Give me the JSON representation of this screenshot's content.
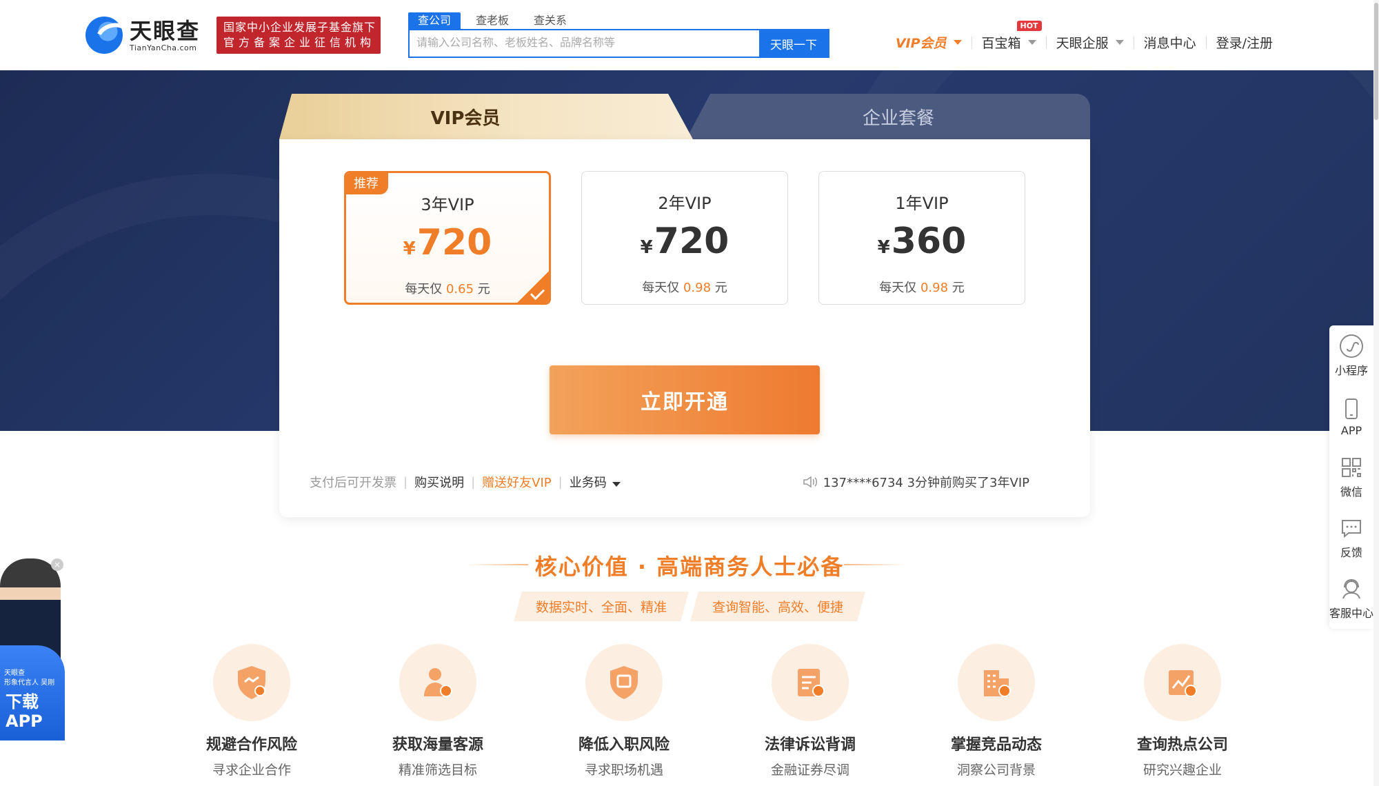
{
  "header": {
    "logo_cn": "天眼查",
    "logo_en": "TianYanCha.com",
    "badge_line1": "国家中小企业发展子基金旗下",
    "badge_line2": "官方备案企业征信机构",
    "search_tabs": [
      "查公司",
      "查老板",
      "查关系"
    ],
    "search_placeholder": "请输入公司名称、老板姓名、品牌名称等",
    "search_button": "天眼一下",
    "nav": {
      "vip": "VIP会员",
      "baibaoxiang": "百宝箱",
      "hot": "HOT",
      "qifu": "天眼企服",
      "messages": "消息中心",
      "login": "登录/注册"
    }
  },
  "tabs": {
    "vip": "VIP会员",
    "enterprise": "企业套餐"
  },
  "plans": [
    {
      "name": "3年VIP",
      "currency": "¥",
      "price": "720",
      "daily_prefix": "每天仅",
      "daily": "0.65",
      "daily_suffix": "元",
      "badge": "推荐",
      "selected": true
    },
    {
      "name": "2年VIP",
      "currency": "¥",
      "price": "720",
      "daily_prefix": "每天仅",
      "daily": "0.98",
      "daily_suffix": "元",
      "selected": false
    },
    {
      "name": "1年VIP",
      "currency": "¥",
      "price": "360",
      "daily_prefix": "每天仅",
      "daily": "0.98",
      "daily_suffix": "元",
      "selected": false
    }
  ],
  "cta": "立即开通",
  "footer_links": {
    "invoice": "支付后可开发票",
    "instructions": "购买说明",
    "gift": "赠送好友VIP",
    "business_code": "业务码"
  },
  "purchase_note": "137****6734 3分钟前购买了3年VIP",
  "core": {
    "title": "核心价值 · 高端商务人士必备",
    "tags": [
      "数据实时、全面、精准",
      "查询智能、高效、便捷"
    ],
    "features": [
      {
        "title": "规避合作风险",
        "sub": "寻求企业合作",
        "icon": "shield-handshake-icon"
      },
      {
        "title": "获取海量客源",
        "sub": "精准筛选目标",
        "icon": "user-search-icon"
      },
      {
        "title": "降低入职风险",
        "sub": "寻求职场机遇",
        "icon": "job-shield-icon"
      },
      {
        "title": "法律诉讼背调",
        "sub": "金融证券尽调",
        "icon": "clipboard-search-icon"
      },
      {
        "title": "掌握竞品动态",
        "sub": "洞察公司背景",
        "icon": "building-icon"
      },
      {
        "title": "查询热点公司",
        "sub": "研究兴趣企业",
        "icon": "trend-search-icon"
      }
    ]
  },
  "sidebar": [
    {
      "label": "小程序",
      "icon": "mini-program-icon"
    },
    {
      "label": "APP",
      "icon": "phone-icon"
    },
    {
      "label": "微信",
      "icon": "qr-code-icon"
    },
    {
      "label": "反馈",
      "icon": "feedback-icon"
    },
    {
      "label": "客服中心",
      "icon": "support-agent-icon"
    }
  ],
  "app_ad": {
    "close": "×",
    "brand_line1": "天眼查",
    "brand_line2": "形象代言人 吴刚",
    "download": "下载",
    "app": "APP"
  },
  "colors": {
    "brand_blue": "#1a73e8",
    "accent_orange": "#f07d28",
    "hero_navy": "#263a6d",
    "badge_red": "#c0262c"
  }
}
